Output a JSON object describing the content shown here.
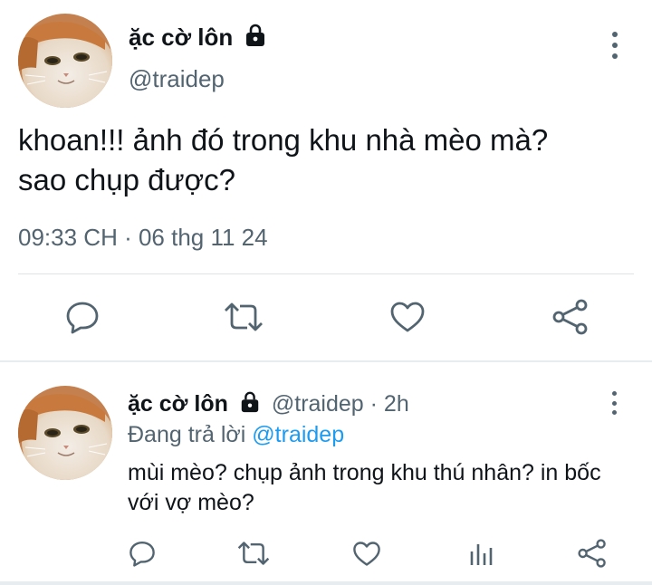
{
  "main_tweet": {
    "display_name": "ặc cờ lôn",
    "handle": "@traidep",
    "text_line1": "khoan!!! ảnh đó trong khu nhà mèo mà?",
    "text_line2": "sao chụp được?",
    "timestamp": "09:33 CH · 06 thg 11 24",
    "avatar_icon": "cat-avatar",
    "lock_icon": "lock-icon",
    "more_icon": "more-vertical-icon",
    "actions": [
      "reply-icon",
      "retweet-icon",
      "like-icon",
      "share-icon"
    ]
  },
  "reply_tweet": {
    "display_name": "ặc cờ lôn",
    "handle_time": "@traidep · 2h",
    "replying_prefix": "Đang trả lời",
    "replying_mention": "@traidep",
    "text": "mùi mèo? chụp ảnh trong khu thú nhân? in bốc với vợ mèo?",
    "avatar_icon": "cat-avatar",
    "lock_icon": "lock-icon",
    "more_icon": "more-vertical-icon",
    "actions": [
      "reply-icon",
      "retweet-icon",
      "like-icon",
      "analytics-icon",
      "share-icon"
    ]
  },
  "colors": {
    "text_primary": "#0f1419",
    "text_secondary": "#536471",
    "link": "#1d9bf0",
    "divider": "#dfe3e6",
    "icon": "#536471"
  }
}
